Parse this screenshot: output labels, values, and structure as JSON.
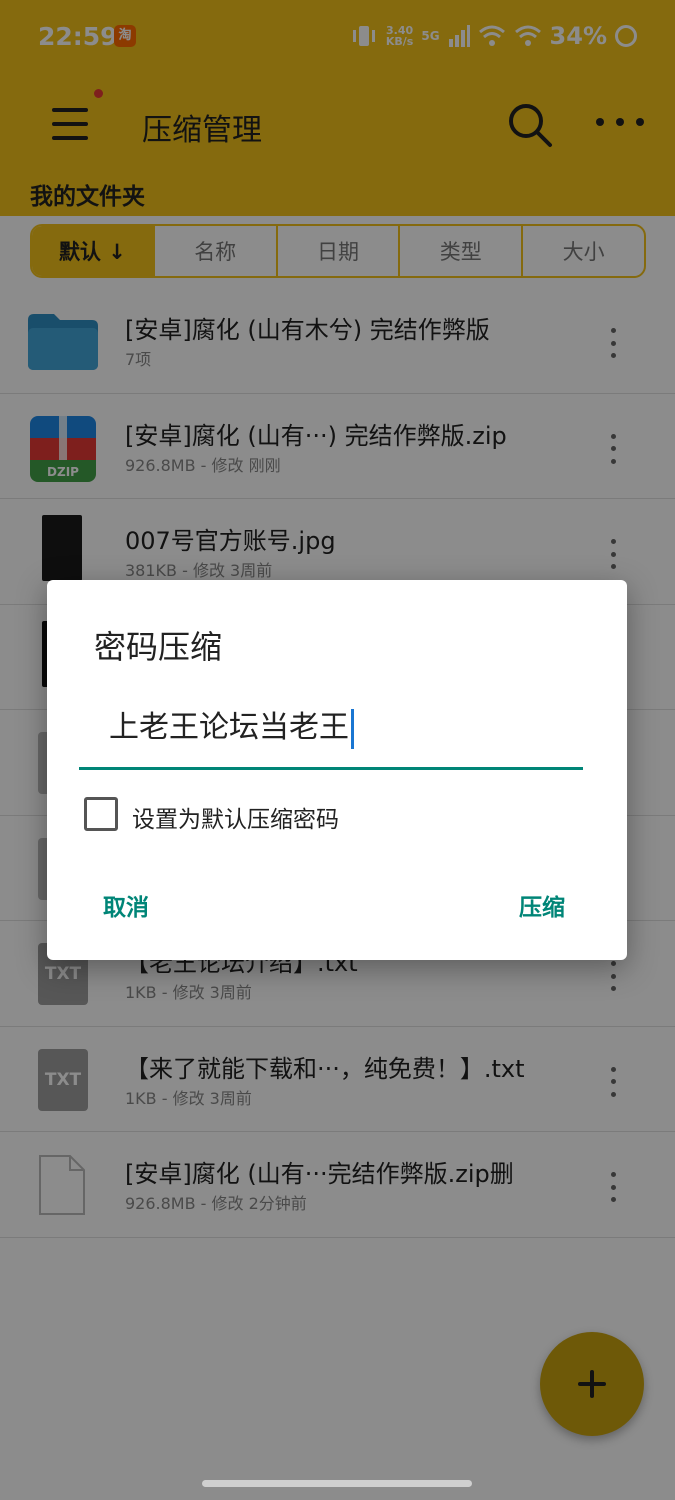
{
  "status_bar": {
    "time": "22:59",
    "app_badge": "淘",
    "net_speed_value": "3.40",
    "net_speed_unit": "KB/s",
    "network": "5G",
    "battery": "34%"
  },
  "app_bar": {
    "title": "压缩管理",
    "folder_label": "我的文件夹",
    "accent_color": "#f2c21b"
  },
  "sort_tabs": [
    {
      "label": "默认 ↓"
    },
    {
      "label": "名称"
    },
    {
      "label": "日期"
    },
    {
      "label": "类型"
    },
    {
      "label": "大小"
    }
  ],
  "files": [
    {
      "name": "[安卓]腐化 (山有木兮) 完结作弊版",
      "meta": "7项",
      "icon": "folder-icon"
    },
    {
      "name": "[安卓]腐化 (山有···) 完结作弊版.zip",
      "meta": "926.8MB - 修改 刚刚",
      "icon": "zip-icon"
    },
    {
      "name": "007号官方账号.jpg",
      "meta": "381KB - 修改 3周前",
      "icon": "image-icon"
    },
    {
      "name": "",
      "meta": "",
      "icon": "image-icon"
    },
    {
      "name": "",
      "meta": "",
      "icon": "file-icon"
    },
    {
      "name": "",
      "meta": "",
      "icon": "file-icon"
    },
    {
      "name": "【老王论坛介绍】.txt",
      "meta": "1KB - 修改 3周前",
      "icon": "txt-icon"
    },
    {
      "name": "【来了就能下载和···，纯免费！】.txt",
      "meta": "1KB - 修改 3周前",
      "icon": "txt-icon"
    },
    {
      "name": "[安卓]腐化 (山有···完结作弊版.zip删",
      "meta": "926.8MB - 修改 2分钟前",
      "icon": "file-icon"
    }
  ],
  "txt_icon_label": "TXT",
  "zip_icon_label": "DZIP",
  "dialog": {
    "title": "密码压缩",
    "password_value": "上老王论坛当老王",
    "checkbox_label": "设置为默认压缩密码",
    "cancel_label": "取消",
    "confirm_label": "压缩",
    "button_color": "#008577"
  }
}
